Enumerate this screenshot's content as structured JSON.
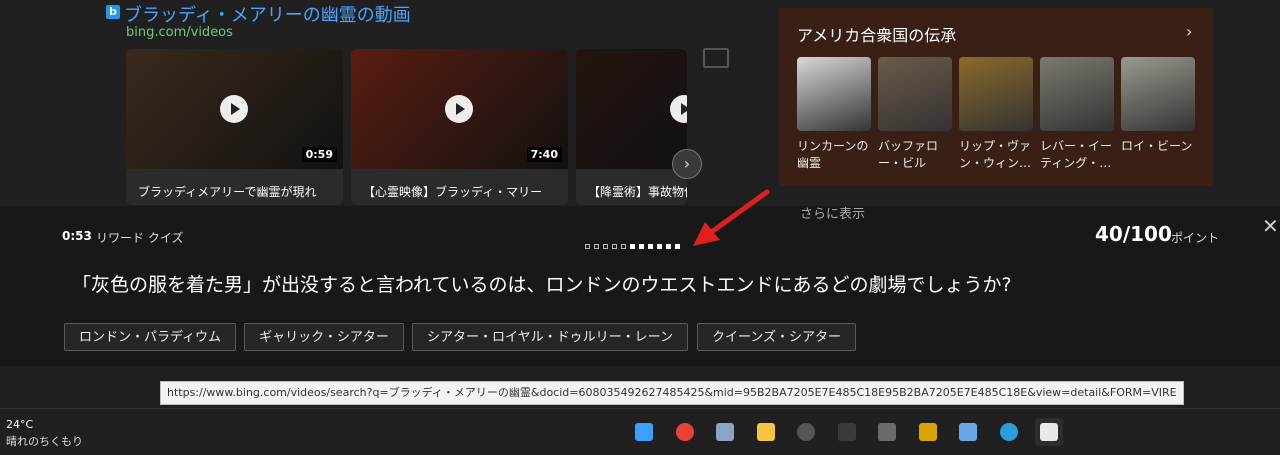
{
  "results": {
    "video_title": "ブラッディ・メアリーの幽霊の動画",
    "video_url": "bing.com/videos",
    "bing_badge": "b",
    "cards": [
      {
        "duration": "0:59",
        "caption": "ブラッディメアリーで幽霊が現れ",
        "thumb_color": "#3a2a1c"
      },
      {
        "duration": "7:40",
        "caption": "【心霊映像】ブラッディ・マリー",
        "thumb_color": "#5a1d12"
      },
      {
        "duration": "",
        "caption": "【降霊術】事故物件",
        "thumb_color": "#241410"
      }
    ],
    "next_arrow": "›",
    "more_label": "さらに表示"
  },
  "knowledge": {
    "title": "アメリカ合衆国の伝承",
    "chevron": "›",
    "items": [
      {
        "name": "リンカーンの幽霊",
        "color": "#d8d8d8"
      },
      {
        "name": "バッファロー・ビル",
        "color": "#6b5a48"
      },
      {
        "name": "リップ・ヴァン・ウィン…",
        "color": "#8a6a2a"
      },
      {
        "name": "レバー・イーティング・…",
        "color": "#7a7a70"
      },
      {
        "name": "ロイ・ビーン",
        "color": "#9a9a90"
      }
    ]
  },
  "quiz": {
    "timer": "0:53",
    "label": "リワード クイズ",
    "points_value": "40/100",
    "points_unit": "ポイント",
    "close": "✕",
    "progress_total": 11,
    "progress_filled": 6,
    "question": "「灰色の服を着た男」が出没すると言われているのは、ロンドンのウエストエンドにあるどの劇場でしょうか?",
    "answers": [
      "ロンドン・パラディウム",
      "ギャリック・シアター",
      "シアター・ロイヤル・ドゥルリー・レーン",
      "クイーンズ・シアター"
    ]
  },
  "tooltip_url": "https://www.bing.com/videos/search?q=ブラッディ・メアリーの幽霊&docid=608035492627485425&mid=95B2BA7205E7E485C18E95B2BA7205E7E485C18E&view=detail&FORM=VIRE",
  "taskbar": {
    "temperature": "24°C",
    "weather": "晴れのちくもり",
    "icons": [
      {
        "name": "windows-start-icon",
        "color": "#3aa0ff"
      },
      {
        "name": "chrome-icon",
        "color": "#e94235"
      },
      {
        "name": "settings-gear-icon",
        "color": "#8aa4c8"
      },
      {
        "name": "file-explorer-icon",
        "color": "#f4c542"
      },
      {
        "name": "obs-icon",
        "color": "#555555"
      },
      {
        "name": "cmd-gui-icon",
        "color": "#3a3a3a"
      },
      {
        "name": "screenshot-tool-icon",
        "color": "#6a6a6a"
      },
      {
        "name": "bee-app-icon",
        "color": "#d9a400"
      },
      {
        "name": "notepad-icon",
        "color": "#6aa6e8"
      },
      {
        "name": "edge-icon",
        "color": "#2a9ed8"
      },
      {
        "name": "document-icon",
        "color": "#e8e8e8"
      }
    ]
  }
}
